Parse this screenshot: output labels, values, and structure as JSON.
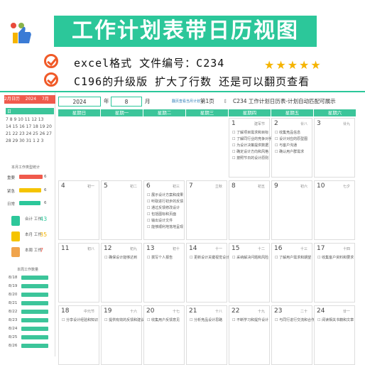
{
  "header": {
    "title": "工作计划表带日历视图",
    "line1": "excel格式  文件编号：C234",
    "line2": "C196的升级版 扩大了行数 还是可以翻页查看",
    "stars": "★★★★★"
  },
  "toolbar": {
    "year": "2024",
    "year_label": "年",
    "month": "8",
    "month_label": "月",
    "plan_link": "翻页查看当月计划",
    "page": "第1页",
    "doc_title": "C234 工作计划日历表-计划自动匹配可展示",
    "badge": "2月日历",
    "badge_year": "2024",
    "badge_month": "7月"
  },
  "weekdays": [
    "星期日",
    "星期一",
    "星期二",
    "星期三",
    "星期四",
    "星期五",
    "星期六"
  ],
  "mini_cal": {
    "headers": [
      "日",
      "一",
      "二",
      "三",
      "四",
      "五",
      "六"
    ],
    "rows": [
      "7 8 9 10 11 12 13",
      "14 15 16 17 18 19 20",
      "21 22 23 24 25 26 27",
      "28 29 30 31 1 2 3"
    ]
  },
  "left_stats": {
    "section1": "本月工作类型统计",
    "types": [
      {
        "label": "重要",
        "value": "6"
      },
      {
        "label": "紧急",
        "value": "6"
      },
      {
        "label": "日常",
        "value": "6"
      }
    ],
    "summary": [
      {
        "label": "合计\n工作",
        "value": "43"
      },
      {
        "label": "本月\n工作",
        "value": "35"
      },
      {
        "label": "本周\n工作",
        "value": "7"
      }
    ],
    "section2": "本周工作数量",
    "dates": [
      "8/18",
      "8/19",
      "8/20",
      "8/21",
      "8/22",
      "8/23",
      "8/24",
      "8/25",
      "8/26"
    ]
  },
  "cells": [
    {
      "day": "1",
      "lunar": "建军节",
      "tasks": [
        "了解项目需求和目标",
        "了解同行业的竞争对手",
        "为设计决策提供数据",
        "确定设计方向和风格",
        "按照节日的设计原则"
      ]
    },
    {
      "day": "2",
      "lunar": "廿八",
      "tasks": [
        "收集竞品信息",
        "设计对应的原型图",
        "与客户沟通",
        "确认用户群需求"
      ]
    },
    {
      "day": "3",
      "lunar": "廿九",
      "tasks": []
    },
    {
      "day": "4",
      "lunar": "初一",
      "tasks": []
    },
    {
      "day": "5",
      "lunar": "初二",
      "tasks": []
    },
    {
      "day": "6",
      "lunar": "初三",
      "tasks": [
        "展示设计方案和成果",
        "听取进行初步的反馈",
        "通过反馈修改设计",
        "包括图标和页面",
        "输出设计文件",
        "能够顺利地落地呈现"
      ]
    },
    {
      "day": "7",
      "lunar": "立秋",
      "tasks": []
    },
    {
      "day": "8",
      "lunar": "初五",
      "tasks": []
    },
    {
      "day": "9",
      "lunar": "初六",
      "tasks": []
    },
    {
      "day": "10",
      "lunar": "七夕",
      "tasks": []
    },
    {
      "day": "11",
      "lunar": "初八",
      "tasks": []
    },
    {
      "day": "12",
      "lunar": "初九",
      "tasks": [
        "确保设计能够达到"
      ]
    },
    {
      "day": "13",
      "lunar": "初十",
      "tasks": [
        "撰写个人报告"
      ]
    },
    {
      "day": "14",
      "lunar": "十一",
      "tasks": [
        "更新设计关键视觉设计"
      ]
    },
    {
      "day": "15",
      "lunar": "十二",
      "tasks": [
        "采纳解决问题和风险"
      ]
    },
    {
      "day": "16",
      "lunar": "十三",
      "tasks": [
        "了解用户需求和期望"
      ]
    },
    {
      "day": "17",
      "lunar": "十四",
      "tasks": [
        "收集客户资料和要求"
      ]
    },
    {
      "day": "18",
      "lunar": "中元节",
      "tasks": [
        "分享设计经验和知识"
      ]
    },
    {
      "day": "19",
      "lunar": "十六",
      "tasks": [
        "提供有效的反馈和建议"
      ]
    },
    {
      "day": "20",
      "lunar": "十七",
      "tasks": [
        "收集用户反馈意见"
      ]
    },
    {
      "day": "21",
      "lunar": "十八",
      "tasks": [
        "分析竞品设计思路"
      ]
    },
    {
      "day": "22",
      "lunar": "十九",
      "tasks": [
        "不断学习和提升设计"
      ]
    },
    {
      "day": "23",
      "lunar": "二十",
      "tasks": [
        "与同行进行交流和合作"
      ]
    },
    {
      "day": "24",
      "lunar": "廿一",
      "tasks": [
        "阅读相关书籍和文章"
      ]
    },
    {
      "day": "25",
      "lunar": "廿二",
      "tasks": [
        "提供视角广阔的视觉"
      ]
    }
  ]
}
